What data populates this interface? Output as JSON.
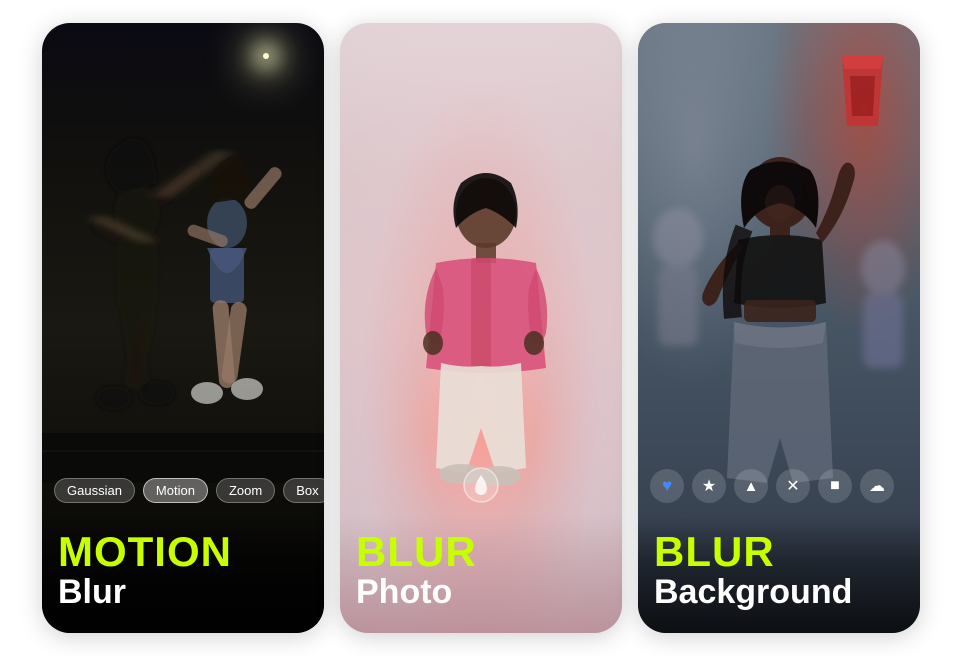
{
  "cards": [
    {
      "id": "motion-blur",
      "title_accent": "MOTION",
      "title_main": "Blur",
      "filters": [
        "Gaussian",
        "Motion",
        "Zoom",
        "Box"
      ],
      "active_filter": "Motion",
      "scene": "night-dancing"
    },
    {
      "id": "blur-photo",
      "title_accent": "BLUR",
      "title_main": "Photo",
      "scene": "pink-fog",
      "drop_icon": "💧"
    },
    {
      "id": "blur-background",
      "title_accent": "BLUR",
      "title_main": "Background",
      "scene": "party",
      "reactions": [
        "💙",
        "⭐",
        "▲",
        "❌",
        "⏹",
        "☁"
      ]
    }
  ],
  "accent_color": "#c8ff00",
  "chip_bg": "rgba(255,255,255,0.18)",
  "icons": {
    "heart": "♥",
    "star": "★",
    "triangle": "▲",
    "target": "✕",
    "square": "■",
    "cloud": "☁"
  }
}
